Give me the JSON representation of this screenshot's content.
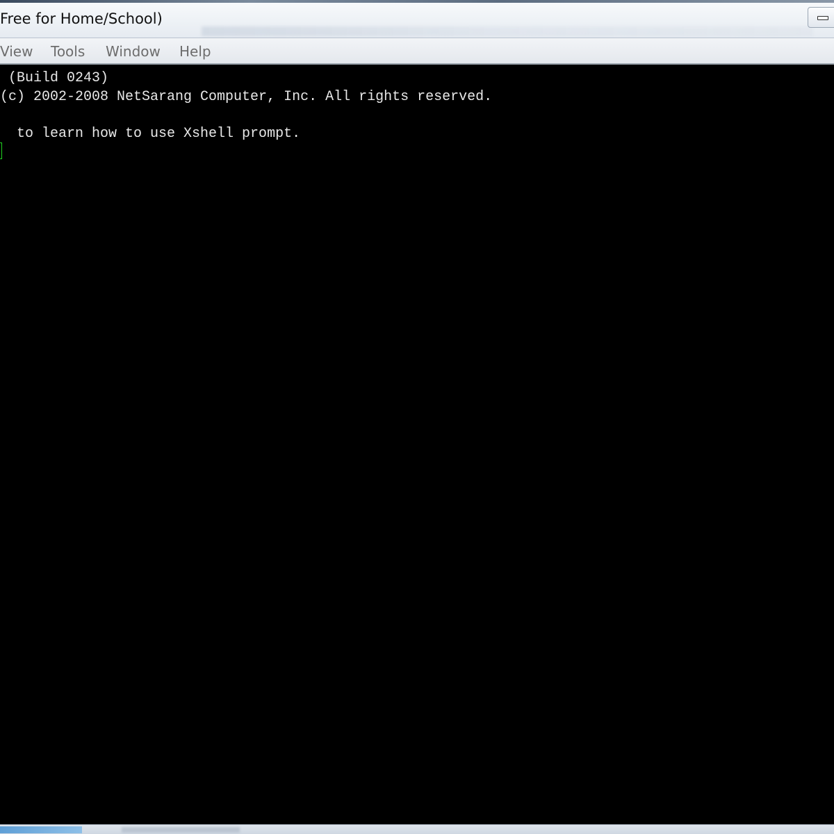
{
  "window": {
    "title": "Free for Home/School)"
  },
  "menu": {
    "items": [
      "View",
      "Tools",
      "Window",
      "Help"
    ]
  },
  "terminal": {
    "lines": [
      " (Build 0243)",
      "(c) 2002-2008 NetSarang Computer, Inc. All rights reserved.",
      "",
      "  to learn how to use Xshell prompt."
    ],
    "cursor_color": "#21d421",
    "background": "#000000",
    "foreground": "#e8e8e8"
  },
  "icons": {
    "minimize": "minimize-icon"
  }
}
